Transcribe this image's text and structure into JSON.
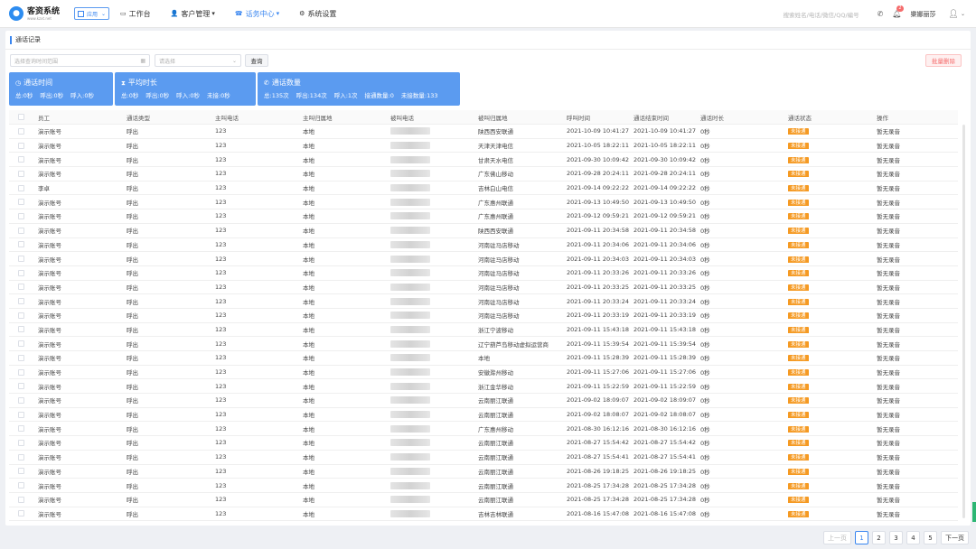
{
  "header": {
    "logo_name": "客资系统",
    "logo_sub": "www.kzxt.net",
    "app_label": "应用",
    "nav": [
      {
        "icon": "desktop-icon",
        "label": "工作台"
      },
      {
        "icon": "users-icon",
        "label": "客户管理"
      },
      {
        "icon": "phone-list-icon",
        "label": "话务中心"
      },
      {
        "icon": "gear-icon",
        "label": "系统设置"
      }
    ],
    "search_placeholder": "搜索姓名/电话/微信/QQ/编号",
    "notification_count": "2",
    "user_name": "樂娜丽莎"
  },
  "breadcrumb": "通话记录",
  "filter": {
    "date_placeholder": "选择查询时间范围",
    "select_placeholder": "请选择",
    "query_label": "查询",
    "batch_delete_label": "批量删除"
  },
  "cards": [
    {
      "title": "通话时间",
      "icon": "clock-icon",
      "stats": [
        "总:0秒",
        "呼出:0秒",
        "呼入:0秒"
      ]
    },
    {
      "title": "平均时长",
      "icon": "hourglass-icon",
      "stats": [
        "总:0秒",
        "呼出:0秒",
        "呼入:0秒",
        "未接:0秒"
      ]
    },
    {
      "title": "通话数量",
      "icon": "phone-icon",
      "stats": [
        "总:135次",
        "呼出:134次",
        "呼入:1次",
        "接通数量:0",
        "未接数量:133"
      ]
    }
  ],
  "colors": {
    "accent": "#3a86f0",
    "card": "#5b9bf0",
    "status_tag": "#f59a23",
    "danger": "#f56c6c"
  },
  "table": {
    "columns": [
      "员工",
      "通话类型",
      "主叫电话",
      "主叫归属地",
      "被叫电话",
      "被叫归属地",
      "呼叫时间",
      "通话结束时间",
      "通话时长",
      "通话状态",
      "操作"
    ],
    "rows": [
      [
        "演示账号",
        "呼出",
        "123",
        "本地",
        "",
        "陕西西安联通",
        "2021-10-09 10:41:27",
        "2021-10-09 10:41:27",
        "0秒",
        "未接通",
        "暂无录音"
      ],
      [
        "演示账号",
        "呼出",
        "123",
        "本地",
        "",
        "天津天津电信",
        "2021-10-05 18:22:11",
        "2021-10-05 18:22:11",
        "0秒",
        "未接通",
        "暂无录音"
      ],
      [
        "演示账号",
        "呼出",
        "123",
        "本地",
        "",
        "甘肃天水电信",
        "2021-09-30 10:09:42",
        "2021-09-30 10:09:42",
        "0秒",
        "未接通",
        "暂无录音"
      ],
      [
        "演示账号",
        "呼出",
        "123",
        "本地",
        "",
        "广东佛山移动",
        "2021-09-28 20:24:11",
        "2021-09-28 20:24:11",
        "0秒",
        "未接通",
        "暂无录音"
      ],
      [
        "李卓",
        "呼出",
        "123",
        "本地",
        "",
        "吉林白山电信",
        "2021-09-14 09:22:22",
        "2021-09-14 09:22:22",
        "0秒",
        "未接通",
        "暂无录音"
      ],
      [
        "演示账号",
        "呼出",
        "123",
        "本地",
        "",
        "广东惠州联通",
        "2021-09-13 10:49:50",
        "2021-09-13 10:49:50",
        "0秒",
        "未接通",
        "暂无录音"
      ],
      [
        "演示账号",
        "呼出",
        "123",
        "本地",
        "",
        "广东惠州联通",
        "2021-09-12 09:59:21",
        "2021-09-12 09:59:21",
        "0秒",
        "未接通",
        "暂无录音"
      ],
      [
        "演示账号",
        "呼出",
        "123",
        "本地",
        "",
        "陕西西安联通",
        "2021-09-11 20:34:58",
        "2021-09-11 20:34:58",
        "0秒",
        "未接通",
        "暂无录音"
      ],
      [
        "演示账号",
        "呼出",
        "123",
        "本地",
        "",
        "河南驻马店移动",
        "2021-09-11 20:34:06",
        "2021-09-11 20:34:06",
        "0秒",
        "未接通",
        "暂无录音"
      ],
      [
        "演示账号",
        "呼出",
        "123",
        "本地",
        "",
        "河南驻马店移动",
        "2021-09-11 20:34:03",
        "2021-09-11 20:34:03",
        "0秒",
        "未接通",
        "暂无录音"
      ],
      [
        "演示账号",
        "呼出",
        "123",
        "本地",
        "",
        "河南驻马店移动",
        "2021-09-11 20:33:26",
        "2021-09-11 20:33:26",
        "0秒",
        "未接通",
        "暂无录音"
      ],
      [
        "演示账号",
        "呼出",
        "123",
        "本地",
        "",
        "河南驻马店移动",
        "2021-09-11 20:33:25",
        "2021-09-11 20:33:25",
        "0秒",
        "未接通",
        "暂无录音"
      ],
      [
        "演示账号",
        "呼出",
        "123",
        "本地",
        "",
        "河南驻马店移动",
        "2021-09-11 20:33:24",
        "2021-09-11 20:33:24",
        "0秒",
        "未接通",
        "暂无录音"
      ],
      [
        "演示账号",
        "呼出",
        "123",
        "本地",
        "",
        "河南驻马店移动",
        "2021-09-11 20:33:19",
        "2021-09-11 20:33:19",
        "0秒",
        "未接通",
        "暂无录音"
      ],
      [
        "演示账号",
        "呼出",
        "123",
        "本地",
        "",
        "浙江宁波移动",
        "2021-09-11 15:43:18",
        "2021-09-11 15:43:18",
        "0秒",
        "未接通",
        "暂无录音"
      ],
      [
        "演示账号",
        "呼出",
        "123",
        "本地",
        "",
        "辽宁葫芦岛移动虚拟运营商",
        "2021-09-11 15:39:54",
        "2021-09-11 15:39:54",
        "0秒",
        "未接通",
        "暂无录音"
      ],
      [
        "演示账号",
        "呼出",
        "123",
        "本地",
        "",
        "本地",
        "2021-09-11 15:28:39",
        "2021-09-11 15:28:39",
        "0秒",
        "未接通",
        "暂无录音"
      ],
      [
        "演示账号",
        "呼出",
        "123",
        "本地",
        "",
        "安徽滁州移动",
        "2021-09-11 15:27:06",
        "2021-09-11 15:27:06",
        "0秒",
        "未接通",
        "暂无录音"
      ],
      [
        "演示账号",
        "呼出",
        "123",
        "本地",
        "",
        "浙江金华移动",
        "2021-09-11 15:22:59",
        "2021-09-11 15:22:59",
        "0秒",
        "未接通",
        "暂无录音"
      ],
      [
        "演示账号",
        "呼出",
        "123",
        "本地",
        "",
        "云南丽江联通",
        "2021-09-02 18:09:07",
        "2021-09-02 18:09:07",
        "0秒",
        "未接通",
        "暂无录音"
      ],
      [
        "演示账号",
        "呼出",
        "123",
        "本地",
        "",
        "云南丽江联通",
        "2021-09-02 18:08:07",
        "2021-09-02 18:08:07",
        "0秒",
        "未接通",
        "暂无录音"
      ],
      [
        "演示账号",
        "呼出",
        "123",
        "本地",
        "",
        "广东惠州移动",
        "2021-08-30 16:12:16",
        "2021-08-30 16:12:16",
        "0秒",
        "未接通",
        "暂无录音"
      ],
      [
        "演示账号",
        "呼出",
        "123",
        "本地",
        "",
        "云南丽江联通",
        "2021-08-27 15:54:42",
        "2021-08-27 15:54:42",
        "0秒",
        "未接通",
        "暂无录音"
      ],
      [
        "演示账号",
        "呼出",
        "123",
        "本地",
        "",
        "云南丽江联通",
        "2021-08-27 15:54:41",
        "2021-08-27 15:54:41",
        "0秒",
        "未接通",
        "暂无录音"
      ],
      [
        "演示账号",
        "呼出",
        "123",
        "本地",
        "",
        "云南丽江联通",
        "2021-08-26 19:18:25",
        "2021-08-26 19:18:25",
        "0秒",
        "未接通",
        "暂无录音"
      ],
      [
        "演示账号",
        "呼出",
        "123",
        "本地",
        "",
        "云南丽江联通",
        "2021-08-25 17:34:28",
        "2021-08-25 17:34:28",
        "0秒",
        "未接通",
        "暂无录音"
      ],
      [
        "演示账号",
        "呼出",
        "123",
        "本地",
        "",
        "云南丽江联通",
        "2021-08-25 17:34:28",
        "2021-08-25 17:34:28",
        "0秒",
        "未接通",
        "暂无录音"
      ],
      [
        "演示账号",
        "呼出",
        "123",
        "本地",
        "",
        "吉林吉林联通",
        "2021-08-16 15:47:08",
        "2021-08-16 15:47:08",
        "0秒",
        "未接通",
        "暂无录音"
      ]
    ]
  },
  "pagination": {
    "prev": "上一页",
    "pages": [
      "1",
      "2",
      "3",
      "4",
      "5"
    ],
    "active": "1",
    "next": "下一页"
  }
}
